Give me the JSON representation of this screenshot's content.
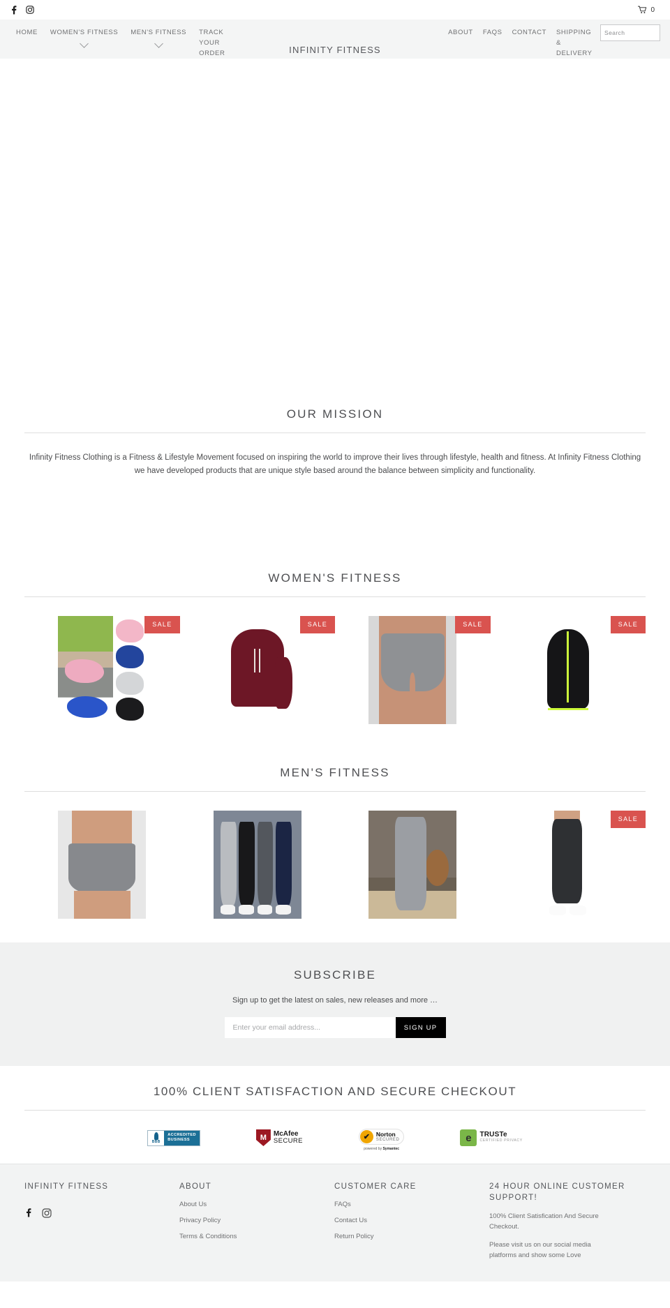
{
  "topbar": {
    "social": [
      {
        "name": "facebook-icon",
        "label": "Facebook"
      },
      {
        "name": "instagram-icon",
        "label": "Instagram"
      }
    ],
    "cart_count": "0"
  },
  "nav": {
    "brand": "INFINITY FITNESS",
    "left_items": [
      {
        "label": "HOME",
        "caret": false
      },
      {
        "label": "WOMEN'S FITNESS",
        "caret": true
      },
      {
        "label": "MEN'S FITNESS",
        "caret": true
      },
      {
        "label": "TRACK YOUR ORDER",
        "caret": false
      }
    ],
    "right_items": [
      {
        "label": "ABOUT"
      },
      {
        "label": "FAQS"
      },
      {
        "label": "CONTACT"
      },
      {
        "label": "SHIPPING & DELIVERY"
      }
    ],
    "search_placeholder": "Search",
    "search_value": ""
  },
  "mission": {
    "title": "OUR MISSION",
    "body": "Infinity Fitness Clothing is a Fitness & Lifestyle Movement focused on inspiring the world to improve their lives through lifestyle, health and fitness. At Infinity Fitness Clothing we have developed products that are unique style based around the balance between simplicity and functionality."
  },
  "womens": {
    "title": "WOMEN'S FITNESS",
    "products": [
      {
        "art": "shoes",
        "badge": "SALE",
        "on_sale": true
      },
      {
        "art": "hoodie",
        "badge": "SALE",
        "on_sale": true
      },
      {
        "art": "shorts",
        "badge": "SALE",
        "on_sale": true
      },
      {
        "art": "jacket",
        "badge": "SALE",
        "on_sale": true
      }
    ]
  },
  "mens": {
    "title": "MEN'S FITNESS",
    "products": [
      {
        "art": "mshorts",
        "badge": "",
        "on_sale": false
      },
      {
        "art": "joggers4",
        "badge": "",
        "on_sale": false
      },
      {
        "art": "gym",
        "badge": "",
        "on_sale": false
      },
      {
        "art": "blackjog",
        "badge": "SALE",
        "on_sale": true
      }
    ]
  },
  "subscribe": {
    "title": "SUBSCRIBE",
    "subtitle": "Sign up to get the latest on sales, new releases and more …",
    "email_placeholder": "Enter your email address...",
    "email_value": "",
    "button_label": "SIGN UP"
  },
  "trust": {
    "title": "100% CLIENT SATISFACTION AND SECURE CHECKOUT",
    "badges": {
      "bbb": {
        "mark": "BBB",
        "line1": "ACCREDITED",
        "line2": "BUSINESS"
      },
      "mcafee": {
        "glyph": "M",
        "line1": "McAfee",
        "line2": "SECURE"
      },
      "norton": {
        "glyph": "✔",
        "line1": "Norton",
        "line2": "SECURED",
        "line3_prefix": "powered by ",
        "line3_brand": "Symantec"
      },
      "truste": {
        "glyph": "e",
        "line1": "TRUSTe",
        "line2": "CERTIFIED PRIVACY"
      }
    }
  },
  "footer": {
    "brand": "INFINITY FITNESS",
    "social": [
      {
        "name": "facebook-icon",
        "label": "Facebook"
      },
      {
        "name": "instagram-icon",
        "label": "Instagram"
      }
    ],
    "about": {
      "heading": "ABOUT",
      "links": [
        "About Us",
        "Privacy Policy",
        "Terms & Conditions"
      ]
    },
    "care": {
      "heading": "CUSTOMER CARE",
      "links": [
        "FAQs",
        "Contact Us",
        "Return Policy"
      ]
    },
    "support": {
      "heading": "24 HOUR ONLINE CUSTOMER SUPPORT!",
      "para1": "100% Client Satisfication And Secure Checkout.",
      "para2": "Please visit us on our social media platforms and show some Love"
    }
  },
  "colors": {
    "sale_badge": "#d9534f",
    "nav_bg": "#f4f5f5",
    "subscribe_bg": "#f0f1f1",
    "footer_bg": "#f2f3f3",
    "text": "#6f7072",
    "button": "#000000"
  }
}
